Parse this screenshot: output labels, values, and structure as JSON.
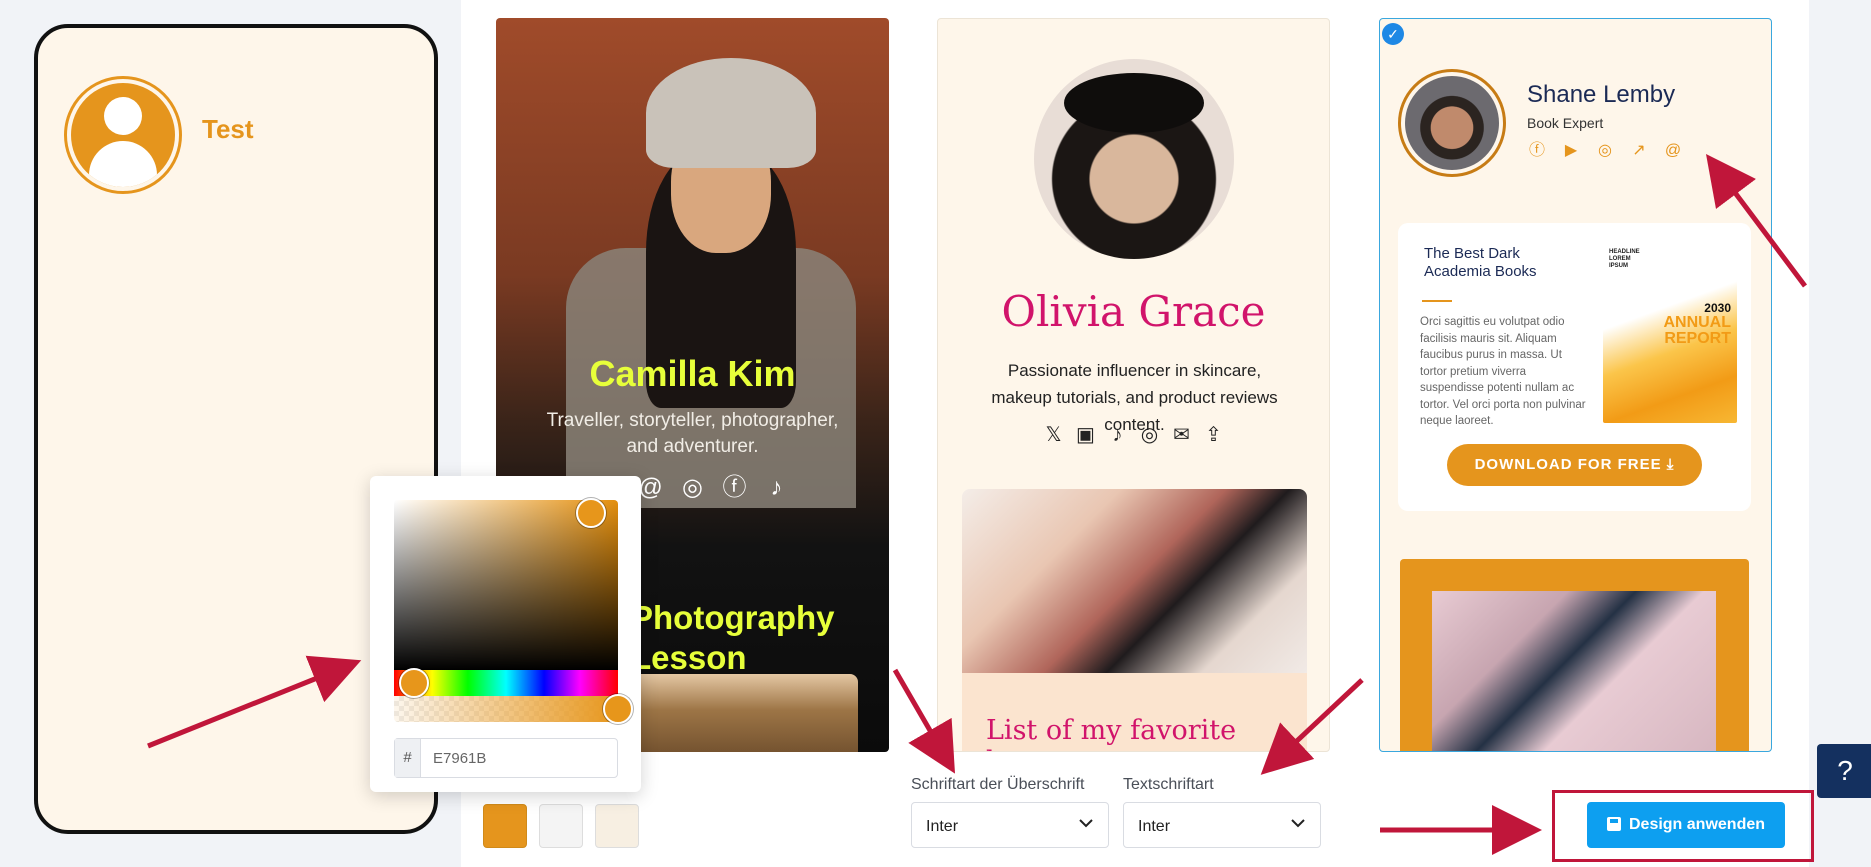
{
  "phone": {
    "profile_name": "Test"
  },
  "templates": [
    {
      "name": "Camilla Kim",
      "bio": "Traveller, storyteller, photographer, and adventurer.",
      "icons": [
        "share-icon",
        "at-icon",
        "instagram-icon",
        "facebook-icon",
        "tiktok-icon"
      ],
      "section_title": "Photography Lesson"
    },
    {
      "name": "Olivia Grace",
      "bio": "Passionate influencer in skincare, makeup tutorials, and product reviews content.",
      "icons": [
        "x-icon",
        "twitch-icon",
        "tiktok-icon",
        "instagram-icon",
        "mail-icon",
        "upload-icon"
      ],
      "list_title": "List of my favorite beauty"
    },
    {
      "selected": true,
      "name": "Shane Lemby",
      "role": "Book Expert",
      "icons": [
        "facebook-icon",
        "youtube-icon",
        "instagram-icon",
        "external-link-icon",
        "at-icon"
      ],
      "promo_title": "The Best Dark Academia Books",
      "promo_text": "Orci sagittis eu volutpat odio facilisis mauris sit. Aliquam faucibus purus in massa. Ut tortor pretium viverra suspendisse potenti nullam ac tortor. Vel orci porta non pulvinar neque laoreet.",
      "cover_header": "HEADLINE LOREM IPSUM",
      "cover_year": "2030",
      "cover_title": "ANNUAL REPORT",
      "download_label": "DOWNLOAD FOR FREE"
    }
  ],
  "color_picker": {
    "hash": "#",
    "hex_value": "E7961B"
  },
  "swatches": [
    "#e5951d",
    "#f4f4f4",
    "#f7efe2"
  ],
  "heading_font": {
    "label": "Schriftart der Überschrift",
    "value": "Inter"
  },
  "text_font": {
    "label": "Textschriftart",
    "value": "Inter"
  },
  "apply_button": {
    "label": "Design anwenden"
  },
  "help_button": {
    "label": "?"
  },
  "colors": {
    "accent": "#e5951d",
    "primary_button": "#0d9ff0",
    "annotation_red": "#c0163a"
  }
}
